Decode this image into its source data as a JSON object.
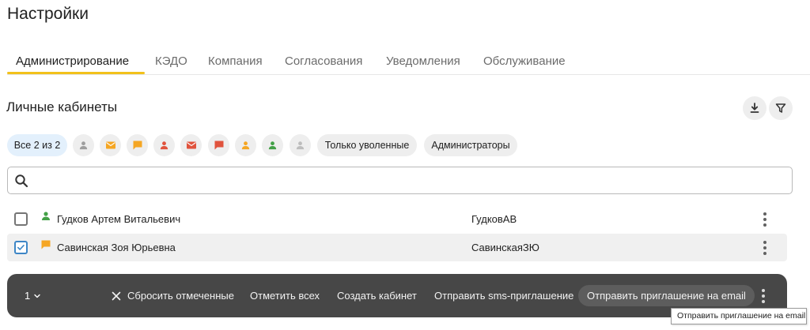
{
  "page": {
    "title": "Настройки"
  },
  "tabs": [
    {
      "label": "Администрирование",
      "active": true
    },
    {
      "label": "КЭДО",
      "active": false
    },
    {
      "label": "Компания",
      "active": false
    },
    {
      "label": "Согласования",
      "active": false
    },
    {
      "label": "Уведомления",
      "active": false
    },
    {
      "label": "Обслуживание",
      "active": false
    }
  ],
  "section": {
    "title": "Личные кабинеты",
    "download_icon": "download-icon",
    "filter_icon": "filter-icon"
  },
  "chips": {
    "all": "Все 2 из 2",
    "icon_filters": [
      {
        "icon": "person-icon",
        "color": "#9e9e9e"
      },
      {
        "icon": "mail-icon",
        "color": "#f5a623"
      },
      {
        "icon": "chat-icon",
        "color": "#f5a623"
      },
      {
        "icon": "person-icon",
        "color": "#e0533d"
      },
      {
        "icon": "mail-icon",
        "color": "#e0533d"
      },
      {
        "icon": "chat-icon",
        "color": "#e0533d"
      },
      {
        "icon": "person-icon",
        "color": "#f5a623"
      },
      {
        "icon": "person-icon",
        "color": "#43a047"
      },
      {
        "icon": "person-icon",
        "color": "#bdbdbd"
      }
    ],
    "fired_only": "Только уволенные",
    "admins": "Администраторы"
  },
  "search": {
    "value": "",
    "placeholder": ""
  },
  "rows": [
    {
      "name": "Гудков Артем Витальевич",
      "login": "ГудковАВ",
      "checked": false,
      "icon": "person-icon",
      "icon_color": "#43a047"
    },
    {
      "name": "Савинская Зоя Юрьевна",
      "login": "СавинскаяЗЮ",
      "checked": true,
      "icon": "chat-icon",
      "icon_color": "#f5a623"
    }
  ],
  "action_bar": {
    "count": "1",
    "reset": "Сбросить отмеченные",
    "select_all": "Отметить всех",
    "create_cabinet": "Создать кабинет",
    "send_sms": "Отправить sms-приглашение",
    "send_email": "Отправить приглашение на email"
  },
  "tooltip": {
    "text": "Отправить приглашение на email"
  }
}
